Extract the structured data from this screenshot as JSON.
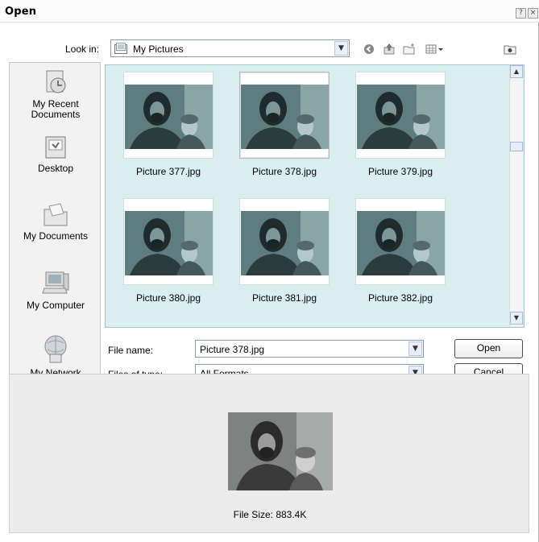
{
  "window": {
    "title": "Open",
    "help_label": "?",
    "close_label": "×"
  },
  "lookin": {
    "label": "Look in:",
    "value": "My Pictures"
  },
  "toolbar": [
    {
      "icon": "back-icon"
    },
    {
      "icon": "up-folder-icon"
    },
    {
      "icon": "new-folder-icon"
    },
    {
      "icon": "views-menu-icon"
    },
    {
      "icon": "preview-toggle-icon"
    }
  ],
  "places": [
    {
      "label": "My Recent Documents",
      "icon": "recent-documents-icon"
    },
    {
      "label": "Desktop",
      "icon": "desktop-icon"
    },
    {
      "label": "My Documents",
      "icon": "my-documents-icon"
    },
    {
      "label": "My Computer",
      "icon": "my-computer-icon"
    },
    {
      "label": "My Network",
      "icon": "my-network-icon"
    }
  ],
  "files": [
    {
      "name": "Picture 377.jpg",
      "selected": false
    },
    {
      "name": "Picture 378.jpg",
      "selected": true
    },
    {
      "name": "Picture 379.jpg",
      "selected": false
    },
    {
      "name": "Picture 380.jpg",
      "selected": false
    },
    {
      "name": "Picture 381.jpg",
      "selected": false
    },
    {
      "name": "Picture 382.jpg",
      "selected": false
    }
  ],
  "filename": {
    "label": "File name:",
    "value": "Picture 378.jpg"
  },
  "filetype": {
    "label": "Files of type:",
    "value": "All Formats"
  },
  "buttons": {
    "open": "Open",
    "cancel": "Cancel"
  },
  "preview": {
    "filesize": "File Size: 883.4K"
  },
  "colors": {
    "list_bg": "#d9eef0",
    "places_bg": "#f2f2f2",
    "preview_bg": "#ececec"
  }
}
